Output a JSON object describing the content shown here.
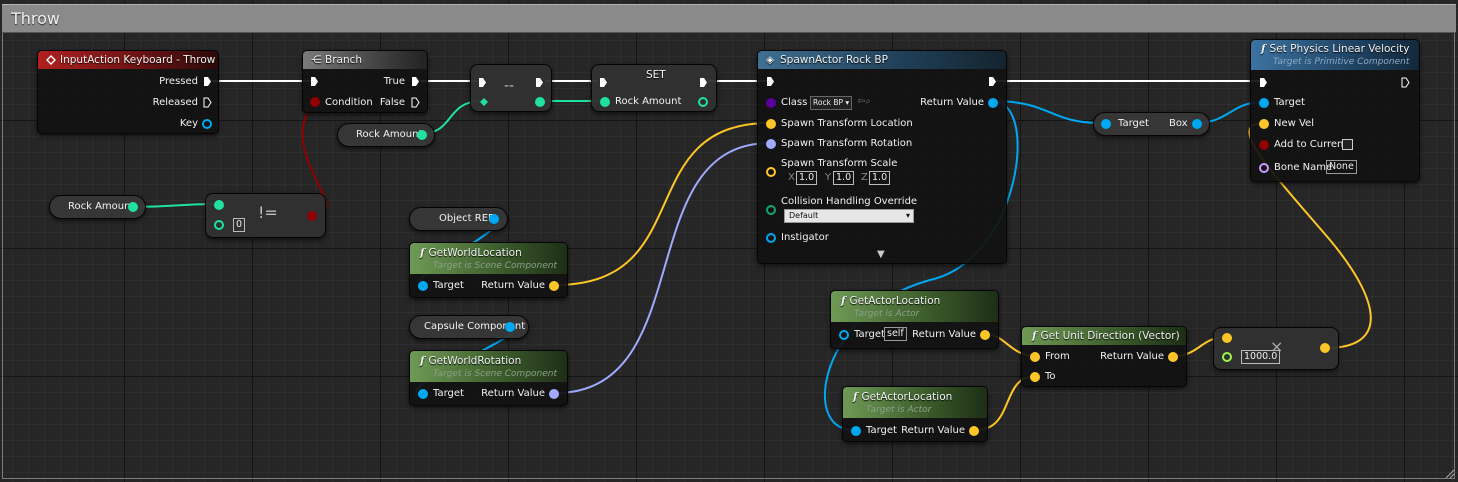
{
  "comment": {
    "title": "Throw"
  },
  "colors": {
    "exec": "#ffffff",
    "float": "#9cf64a",
    "int": "#1fe2a0",
    "bool": "#920101",
    "vector": "#fdc628",
    "rotator": "#a0aaff",
    "object": "#00a8f2",
    "class": "#5a009e",
    "name": "#cc99ff",
    "transform": "#ff7300"
  },
  "nodes": {
    "input_action": {
      "title": "InputAction Keyboard - Throw",
      "pins": {
        "pressed": "Pressed",
        "released": "Released",
        "key": "Key"
      }
    },
    "branch": {
      "title": "Branch",
      "pins": {
        "condition": "Condition",
        "true": "True",
        "false": "False"
      }
    },
    "decrement": {
      "title": "--"
    },
    "set": {
      "title": "SET",
      "pins": {
        "rock_amount": "Rock Amount"
      }
    },
    "rock_amount_get_1": {
      "label": "Rock Amount"
    },
    "rock_amount_get_2": {
      "label": "Rock Amount"
    },
    "not_equal": {
      "title": "!=",
      "value": "0"
    },
    "object_ref": {
      "label": "Object REF"
    },
    "capsule": {
      "label": "Capsule Component"
    },
    "get_world_location": {
      "title": "GetWorldLocation",
      "subtitle": "Target is Scene Component",
      "pins": {
        "target": "Target",
        "return": "Return Value"
      }
    },
    "get_world_rotation": {
      "title": "GetWorldRotation",
      "subtitle": "Target is Scene Component",
      "pins": {
        "target": "Target",
        "return": "Return Value"
      }
    },
    "spawn_actor": {
      "title": "SpawnActor Rock BP",
      "pins": {
        "class": "Class",
        "class_value": "Rock BP",
        "return": "Return Value",
        "loc": "Spawn Transform Location",
        "rot": "Spawn Transform Rotation",
        "scale": "Spawn Transform Scale",
        "x": "1.0",
        "y": "1.0",
        "z": "1.0",
        "collision": "Collision Handling Override",
        "collision_value": "Default",
        "instigator": "Instigator"
      }
    },
    "get_actor_location_1": {
      "title": "GetActorLocation",
      "subtitle": "Target is Actor",
      "pins": {
        "target": "Target",
        "self": "self",
        "return": "Return Value"
      }
    },
    "get_actor_location_2": {
      "title": "GetActorLocation",
      "subtitle": "Target is Actor",
      "pins": {
        "target": "Target",
        "return": "Return Value"
      }
    },
    "unit_direction": {
      "title": "Get Unit Direction (Vector)",
      "pins": {
        "from": "From",
        "to": "To",
        "return": "Return Value"
      }
    },
    "multiply": {
      "title": "×",
      "value": "1000.0"
    },
    "box_get": {
      "pins": {
        "target": "Target",
        "box": "Box"
      }
    },
    "set_physics": {
      "title": "Set Physics Linear Velocity",
      "subtitle": "Target is Primitive Component",
      "pins": {
        "target": "Target",
        "new_vel": "New Vel",
        "add": "Add to Current",
        "bone": "Bone Name",
        "bone_value": "None"
      }
    }
  }
}
